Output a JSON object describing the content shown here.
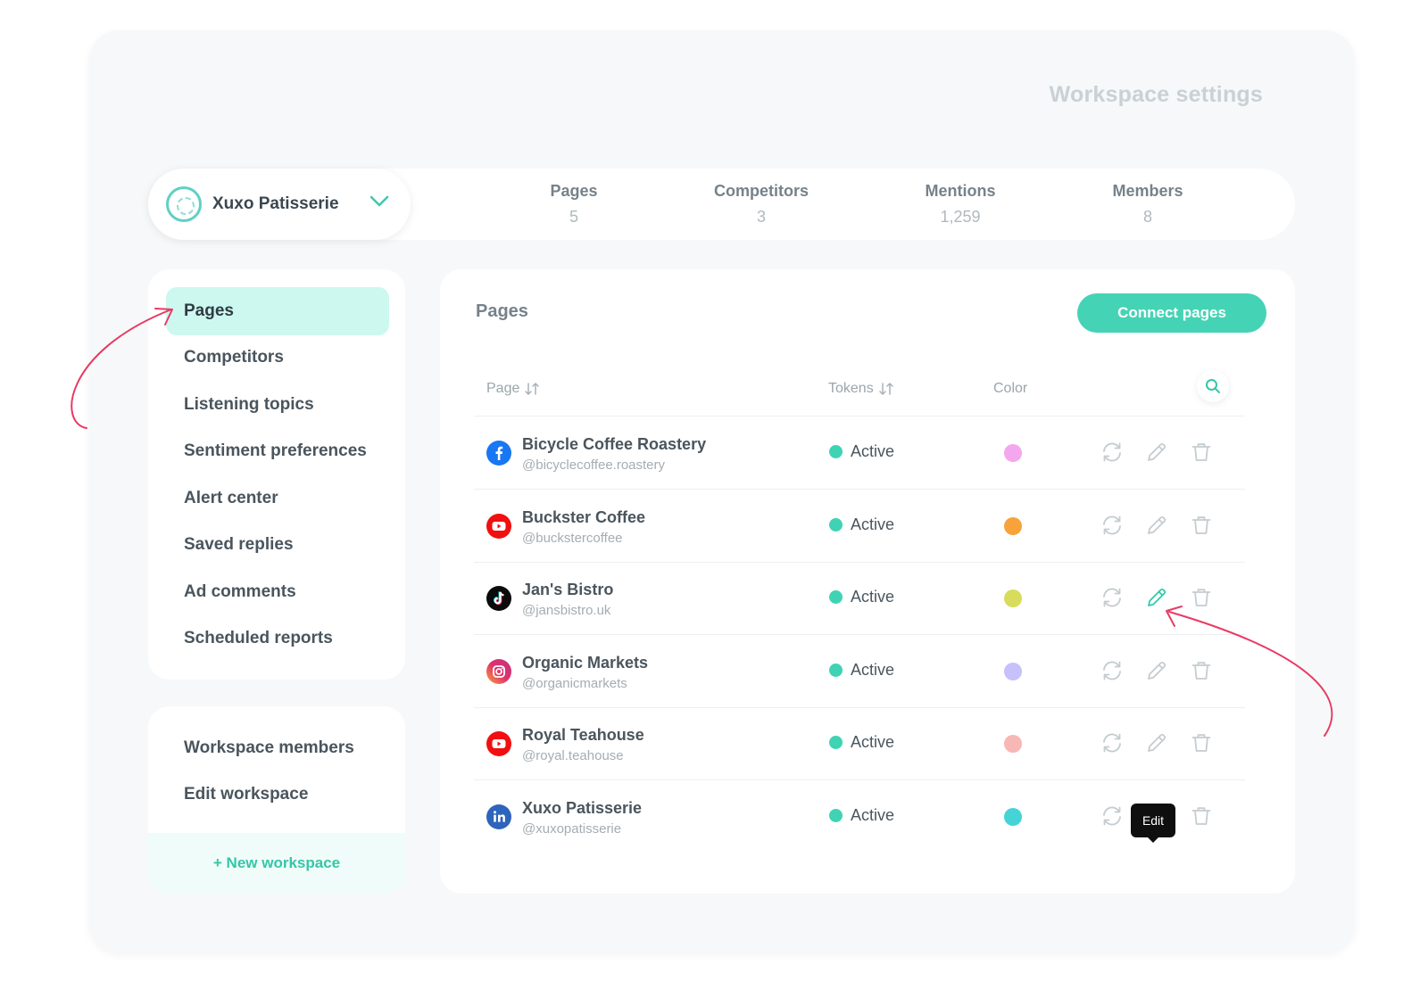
{
  "header": {
    "title": "Workspace settings"
  },
  "workspace": {
    "name": "Xuxo Patisserie"
  },
  "stats": [
    {
      "label": "Pages",
      "value": "5"
    },
    {
      "label": "Competitors",
      "value": "3"
    },
    {
      "label": "Mentions",
      "value": "1,259"
    },
    {
      "label": "Members",
      "value": "8"
    }
  ],
  "sidebar": {
    "items": [
      {
        "label": "Pages"
      },
      {
        "label": "Competitors"
      },
      {
        "label": "Listening topics"
      },
      {
        "label": "Sentiment preferences"
      },
      {
        "label": "Alert center"
      },
      {
        "label": "Saved replies"
      },
      {
        "label": "Ad comments"
      },
      {
        "label": "Scheduled reports"
      }
    ],
    "secondary": [
      {
        "label": "Workspace members"
      },
      {
        "label": "Edit workspace"
      }
    ],
    "new_workspace": "+ New workspace"
  },
  "main": {
    "title": "Pages",
    "connect_label": "Connect pages",
    "columns": {
      "page": "Page",
      "tokens": "Tokens",
      "color": "Color"
    },
    "tooltip": "Edit",
    "rows": [
      {
        "name": "Bicycle Coffee Roastery",
        "handle": "@bicyclecoffee.roastery",
        "network": "facebook-icon",
        "status": "Active",
        "color": "#f4a6ee"
      },
      {
        "name": "Buckster Coffee",
        "handle": "@bucks­tercoffee",
        "network": "youtube-icon",
        "status": "Active",
        "color": "#f8a33a"
      },
      {
        "name": "Jan's Bistro",
        "handle": "@jansbistro.uk",
        "network": "tiktok-icon",
        "status": "Active",
        "color": "#d8dc5b"
      },
      {
        "name": "Organic Markets",
        "handle": "@organicmarkets",
        "network": "instagram-icon",
        "status": "Active",
        "color": "#c6c0fb"
      },
      {
        "name": "Royal Teahouse",
        "handle": "@royal.teahouse",
        "network": "youtube-icon",
        "status": "Active",
        "color": "#f7b7b5"
      },
      {
        "name": "Xuxo Patisserie",
        "handle": "@xuxopatisserie",
        "network": "linkedin-icon",
        "status": "Active",
        "color": "#44d4d6"
      }
    ]
  },
  "colors": {
    "accent": "#45d3b5",
    "active_menu": "#cdf8ef",
    "annotation": "#e83a63"
  }
}
